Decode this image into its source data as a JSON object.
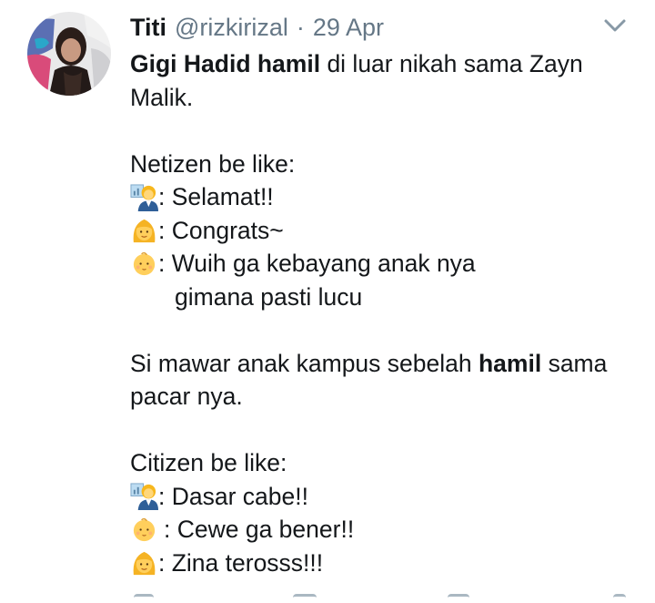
{
  "tweet": {
    "author_name": "Titi",
    "handle": "@rizkirizal",
    "separator": "·",
    "date": "29 Apr",
    "lines": {
      "l1a": "Gigi Hadid hamil",
      "l1b": " di luar nikah sama Zayn",
      "l2": "Malik.",
      "l3": "Netizen be like:",
      "l4": ": Selamat!!",
      "l5": ": Congrats~",
      "l6": ": Wuih ga kebayang anak nya",
      "l7": "gimana pasti lucu",
      "l8a": "Si mawar anak kampus sebelah ",
      "l8b": "hamil",
      "l8c": " sama",
      "l9": "pacar nya.",
      "l10": "Citizen be like:",
      "l11": ": Dasar cabe!!",
      "l12": ": Cewe ga bener!!",
      "l13": ": Zina terosss!!!"
    },
    "icons": {
      "caret": "chevron-down-icon",
      "emoji_a": "woman-teacher-emoji",
      "emoji_b": "blond-woman-emoji",
      "emoji_c": "baby-face-emoji"
    },
    "colors": {
      "text": "#14171a",
      "muted": "#657786",
      "caret": "#8899a6"
    }
  }
}
